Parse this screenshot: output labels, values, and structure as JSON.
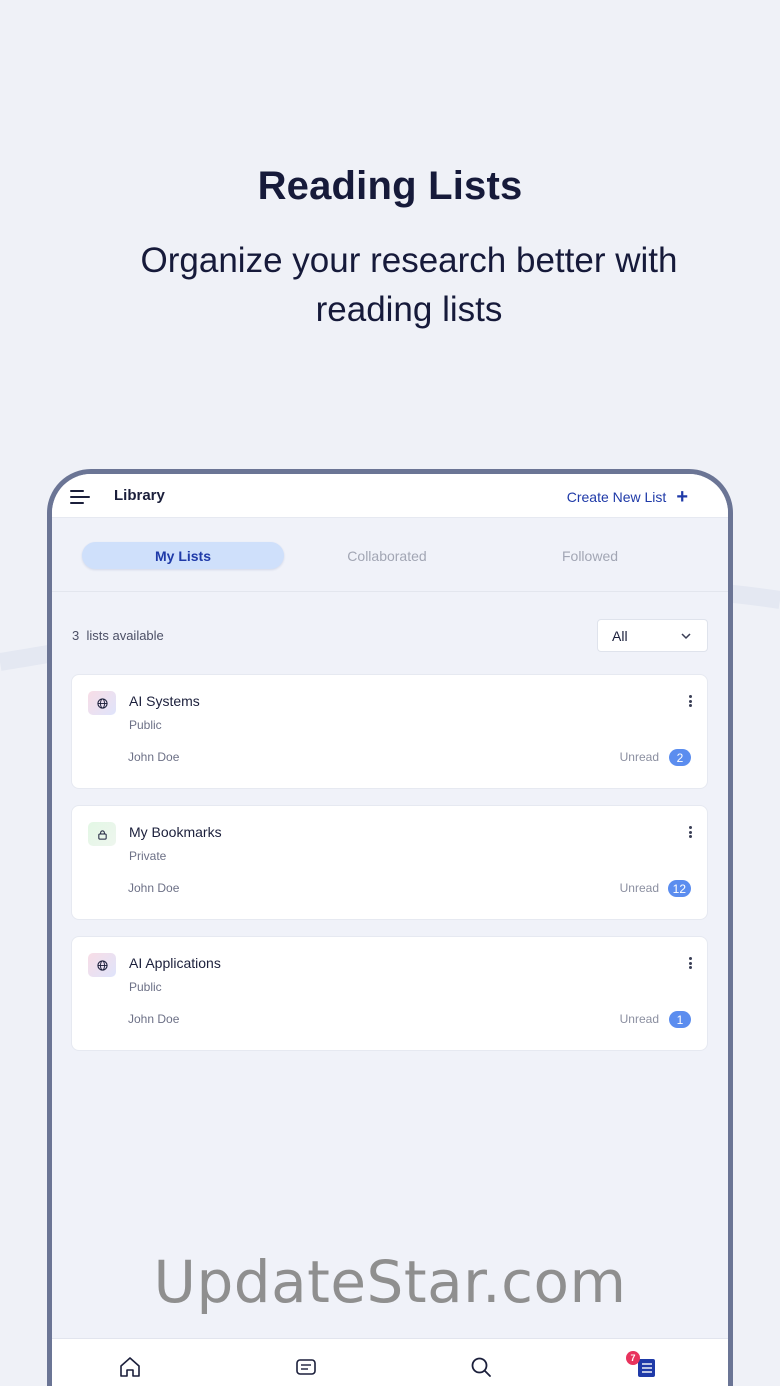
{
  "hero": {
    "title": "Reading Lists",
    "subtitle": "Organize your research better with reading lists"
  },
  "topbar": {
    "title": "Library",
    "create_label": "Create New List"
  },
  "tabs": [
    {
      "label": "My Lists",
      "active": true
    },
    {
      "label": "Collaborated",
      "active": false
    },
    {
      "label": "Followed",
      "active": false
    }
  ],
  "summary": {
    "count": "3",
    "count_suffix": "lists available"
  },
  "filter": {
    "selected": "All"
  },
  "lists": [
    {
      "title": "AI Systems",
      "visibility": "Public",
      "owner": "John Doe",
      "unread_label": "Unread",
      "unread_count": "2",
      "icon": "globe-icon"
    },
    {
      "title": "My Bookmarks",
      "visibility": "Private",
      "owner": "John Doe",
      "unread_label": "Unread",
      "unread_count": "12",
      "icon": "lock-icon"
    },
    {
      "title": "AI Applications",
      "visibility": "Public",
      "owner": "John Doe",
      "unread_label": "Unread",
      "unread_count": "1",
      "icon": "globe-icon"
    }
  ],
  "bottom_nav": {
    "items": [
      "home-icon",
      "feed-icon",
      "search-icon",
      "library-icon"
    ],
    "library_badge": "7"
  },
  "watermark": "UpdateStar.com",
  "colors": {
    "accent": "#1f3aa8",
    "badge": "#5b8def",
    "notification": "#e8335d",
    "background": "#eff1f7"
  }
}
